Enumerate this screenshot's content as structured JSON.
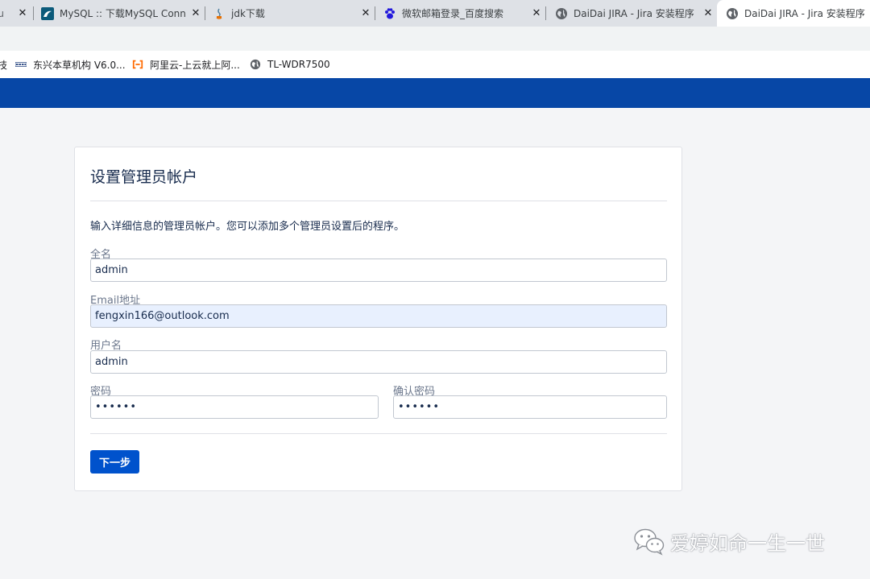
{
  "browser": {
    "tabs": [
      {
        "title": "lu",
        "favicon": "page-icon",
        "active": false
      },
      {
        "title": "MySQL :: 下载MySQL Connec",
        "favicon": "mysql-icon",
        "active": false
      },
      {
        "title": "jdk下载",
        "favicon": "java-icon",
        "active": false
      },
      {
        "title": "微软邮箱登录_百度搜索",
        "favicon": "baidu-paw-icon",
        "active": false
      },
      {
        "title": "DaiDai JIRA - Jira 安装程序",
        "favicon": "globe-icon",
        "active": false
      },
      {
        "title": "DaiDai JIRA - Jira 安装程序",
        "favicon": "globe-icon",
        "active": true
      }
    ],
    "close_glyph": "✕",
    "bookmarks": [
      {
        "label": "技",
        "icon": ""
      },
      {
        "label": "东兴本草机构 V6.0...",
        "icon": "bookmark-site-icon"
      },
      {
        "label": "阿里云-上云就上阿...",
        "icon": "aliyun-icon"
      },
      {
        "label": "TL-WDR7500",
        "icon": "globe-icon"
      }
    ]
  },
  "form": {
    "title": "设置管理员帐户",
    "description": "输入详细信息的管理员帐户。您可以添加多个管理员设置后的程序。",
    "fullname": {
      "label": "全名",
      "value": "admin"
    },
    "email": {
      "label": "Email地址",
      "value": "fengxin166@outlook.com"
    },
    "username": {
      "label": "用户名",
      "value": "admin"
    },
    "password": {
      "label": "密码",
      "value": "••••••"
    },
    "confirm_password": {
      "label": "确认密码",
      "value": "••••••"
    },
    "next_button": "下一步"
  },
  "watermark": {
    "text": "爱婷如命一生一世"
  },
  "colors": {
    "jira_header": "#0747a6",
    "primary_button": "#0052cc",
    "autofill_bg": "#e8f0fe",
    "page_bg": "#f4f5f7"
  }
}
